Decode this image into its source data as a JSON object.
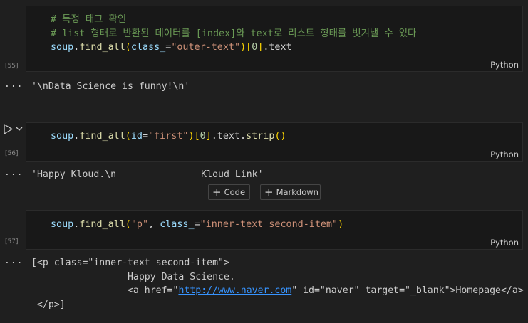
{
  "cells": [
    {
      "exec_count": "[55]",
      "language": "Python",
      "comment1": "# 특정 태그 확인",
      "comment2": "# list 형태로 반환된 데이터를 [index]와 text로 리스트 형태를 벗겨낼 수 있다",
      "code": {
        "obj": "soup",
        "dot": ".",
        "fn": "find_all",
        "lp": "(",
        "arg": "class_",
        "eq": "=",
        "str": "\"outer-text\"",
        "rp": ")",
        "lb": "[",
        "idx": "0",
        "rb": "]",
        "tail": ".text"
      },
      "output": "'\\nData Science is funny!\\n'"
    },
    {
      "exec_count": "[56]",
      "language": "Python",
      "code": {
        "obj": "soup",
        "dot": ".",
        "fn": "find_all",
        "lp": "(",
        "arg": "id",
        "eq": "=",
        "str": "\"first\"",
        "rp": ")",
        "lb": "[",
        "idx": "0",
        "rb": "]",
        "tail1": ".text.",
        "fn2": "strip",
        "call": "()"
      },
      "output": "'Happy Kloud.\\n               Kloud Link'"
    },
    {
      "exec_count": "[57]",
      "language": "Python",
      "code": {
        "obj": "soup",
        "dot": ".",
        "fn": "find_all",
        "lp": "(",
        "str1": "\"p\"",
        "comma": ", ",
        "arg": "class_",
        "eq": "=",
        "str2": "\"inner-text second-item\"",
        "rp": ")"
      },
      "output": {
        "line1": "[<p class=\"inner-text second-item\">",
        "line2": "                 Happy Data Science.",
        "line3_pre": "                 <a href=\"",
        "line3_link": "http://www.naver.com",
        "line3_post": "\" id=\"naver\" target=\"_blank\">Homepage</a>",
        "line4": " </p>]"
      }
    }
  ],
  "add_bar": {
    "code_label": "Code",
    "markdown_label": "Markdown"
  },
  "output_marker": "...",
  "colors": {
    "bg": "#1f1f1f",
    "cell_bg": "#181818",
    "comment": "#6a9955",
    "string": "#ce9178",
    "function": "#dcdcaa",
    "variable": "#9cdcfe",
    "number": "#b5cea8"
  }
}
